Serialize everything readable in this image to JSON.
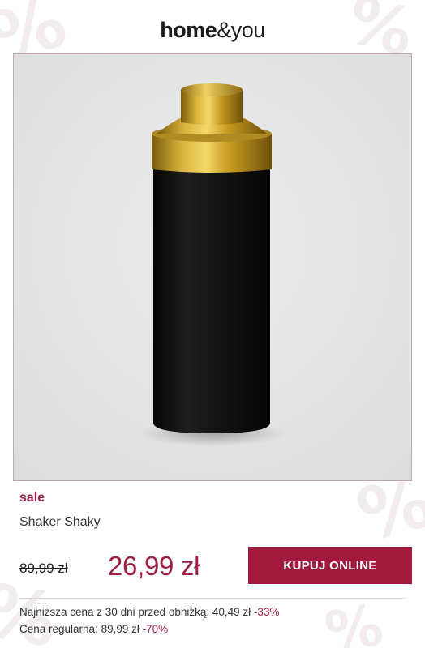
{
  "header": {
    "logo_part1": "home",
    "logo_part2": "&you"
  },
  "product": {
    "image_icon": "cocktail-shaker-image",
    "sale_label": "sale",
    "name": "Shaker Shaky",
    "old_price": "89,99 zł",
    "new_price": "26,99 zł",
    "buy_label": "KUPUJ ONLINE"
  },
  "price_info": {
    "lowest_text": "Najniższa cena z 30 dni przed obniżką: 40,49 zł",
    "lowest_discount": "-33%",
    "regular_text": "Cena regularna: 89,99 zł",
    "regular_discount": "-70%"
  },
  "colors": {
    "accent": "#9e1f43",
    "button": "#a3183d",
    "card_border": "#c9a7b3",
    "image_background": "#e4e4e4",
    "shaker_body": "#111111",
    "shaker_cap": "#c9a227"
  }
}
